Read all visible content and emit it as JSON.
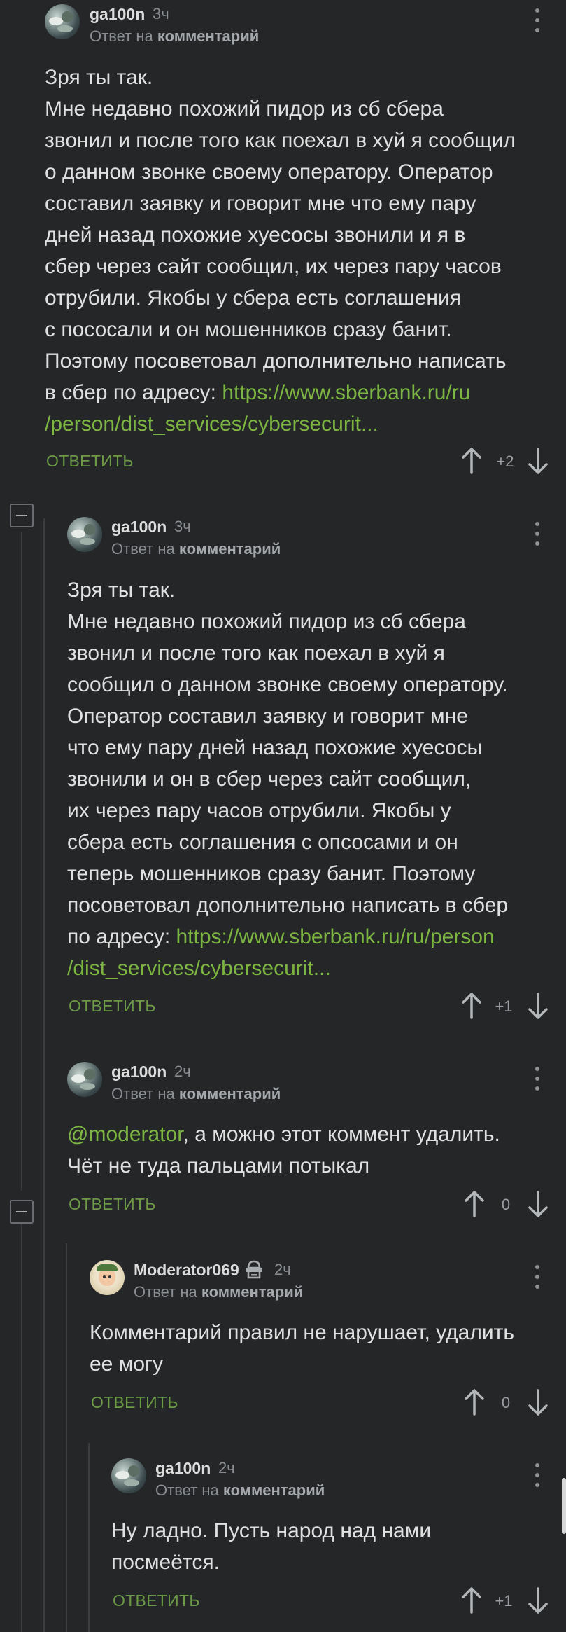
{
  "comments": [
    {
      "author": "ga100n",
      "time": "3ч",
      "reply_to_prefix": "Ответ на",
      "reply_to_link": "комментарий",
      "lines": [
        "Зря ты так.",
        "Мне недавно похожий пидор из сб сбера",
        "звонил и после того как поехал в хуй я сообщил",
        "о данном звонке своему оператору. Оператор",
        "составил заявку и говорит мне что ему пару",
        "дней назад похожие хуесосы звонили и я в",
        "сбер через сайт сообщил, их через пару часов",
        "отрубили. Якобы у сбера есть соглашения",
        "с пососали и он мошенников сразу банит.",
        "Поэтому посоветовал дополнительно написать",
        "в сбер по адресу: "
      ],
      "link_line1": "https://www.sberbank.ru/ru",
      "link_line2": "/person/dist_services/cybersecurit...",
      "reply_label": "ОТВЕТИТЬ",
      "score": "+2"
    },
    {
      "author": "ga100n",
      "time": "3ч",
      "reply_to_prefix": "Ответ на",
      "reply_to_link": "комментарий",
      "lines": [
        "Зря ты так.",
        "Мне недавно похожий пидор из сб сбера",
        "звонил и после того как поехал в хуй я",
        "сообщил о данном звонке своему оператору.",
        "Оператор составил заявку и говорит мне",
        "что ему пару дней назад похожие хуесосы",
        "звонили и он в сбер через сайт сообщил,",
        "их через пару часов отрубили. Якобы у",
        "сбера есть соглашения с опсосами и он",
        "теперь мошенников сразу банит. Поэтому",
        "посоветовал дополнительно написать в сбер",
        "по адресу: "
      ],
      "link_line1": "https://www.sberbank.ru/ru/person",
      "link_line2": "/dist_services/cybersecurit...",
      "reply_label": "ОТВЕТИТЬ",
      "score": "+1"
    },
    {
      "author": "ga100n",
      "time": "2ч",
      "reply_to_prefix": "Ответ на",
      "reply_to_link": "комментарий",
      "mention": "@moderator",
      "line1_rest": ", а можно этот коммент удалить.",
      "line2": "Чёт не туда пальцами потыкал",
      "reply_label": "ОТВЕТИТЬ",
      "score": "0"
    },
    {
      "author": "Moderator069",
      "time": "2ч",
      "reply_to_prefix": "Ответ на",
      "reply_to_link": "комментарий",
      "line1": "Комментарий правил не нарушает, удалить",
      "line2": "ее могу",
      "reply_label": "ОТВЕТИТЬ",
      "score": "0"
    },
    {
      "author": "ga100n",
      "time": "2ч",
      "reply_to_prefix": "Ответ на",
      "reply_to_link": "комментарий",
      "line1": "Ну ладно. Пусть народ над нами",
      "line2": "посмеётся.",
      "reply_label": "ОТВЕТИТЬ",
      "score": "+1"
    }
  ]
}
